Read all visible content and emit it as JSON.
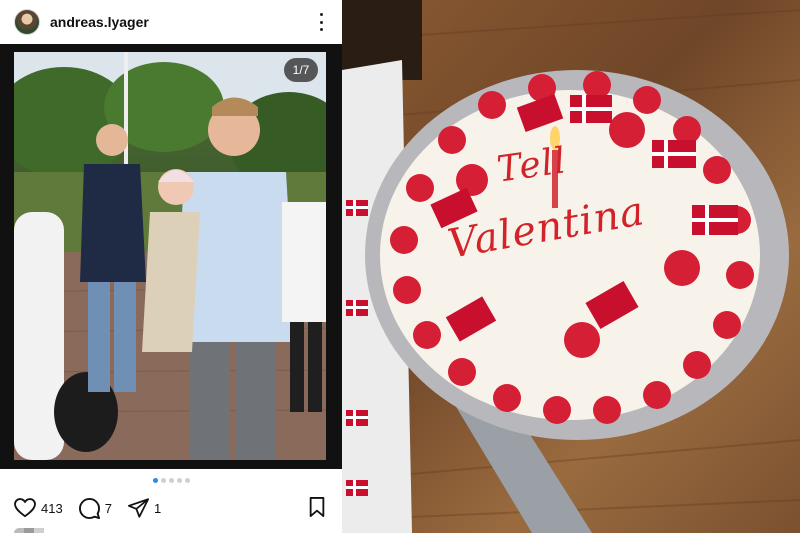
{
  "post": {
    "username": "andreas.lyager",
    "image_counter": "1/7",
    "carousel": {
      "total": 5,
      "active_index": 0
    },
    "likes": "413",
    "comments": "7",
    "shares": "1"
  },
  "cake": {
    "line1": "Tell",
    "line2": "Valentina"
  },
  "colors": {
    "accent_blue": "#2f8ae0",
    "frosting_red": "#d2232a",
    "flag_red": "#c8102e"
  },
  "icons": {
    "more": "more-vertical-icon",
    "like": "heart-icon",
    "comment": "comment-bubble-icon",
    "share": "paper-plane-icon",
    "save": "bookmark-icon"
  }
}
